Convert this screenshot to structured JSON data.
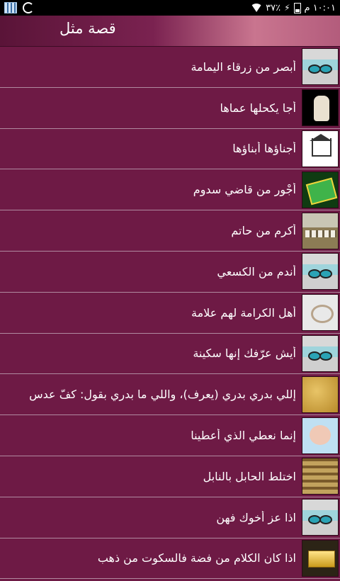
{
  "status_bar": {
    "time": "١٠:٠١ م",
    "battery_percent": "٣٧٪",
    "icons": [
      "qr-icon",
      "sync-icon",
      "wifi-icon",
      "charging-bolt-icon",
      "battery-icon"
    ]
  },
  "action_bar": {
    "title": "قصة مثل"
  },
  "list": {
    "items": [
      {
        "label": "أبصر من زرقاء اليمامة",
        "thumb": "eyes"
      },
      {
        "label": "أجا يكحلها عماها",
        "thumb": "dog"
      },
      {
        "label": "أجناؤها أبناؤها",
        "thumb": "house"
      },
      {
        "label": "أجْور من قاضي سدوم",
        "thumb": "money"
      },
      {
        "label": "أكرم من حاتم",
        "thumb": "sheep"
      },
      {
        "label": "أندم من الكسعي",
        "thumb": "eyes"
      },
      {
        "label": "أهل الكرامة لهم علامة",
        "thumb": "ring"
      },
      {
        "label": "أيش عرّفك إنها سكينة",
        "thumb": "eyes"
      },
      {
        "label": "إللي بدري بدري (يعرف)، واللي ما بدري بقول: كفّ عدس",
        "thumb": "sand"
      },
      {
        "label": "إنما نعطي الذي أعطينا",
        "thumb": "baby"
      },
      {
        "label": "اختلط الحابل بالنابل",
        "thumb": "crowd"
      },
      {
        "label": "اذا عز أخوك فهن",
        "thumb": "eyes"
      },
      {
        "label": "اذا كان الكلام من فضة فالسكوت من ذهب",
        "thumb": "gold"
      }
    ]
  },
  "colors": {
    "list_background": "#6e1a45",
    "row_divider": "#b08aa0",
    "text": "#ffffff"
  }
}
